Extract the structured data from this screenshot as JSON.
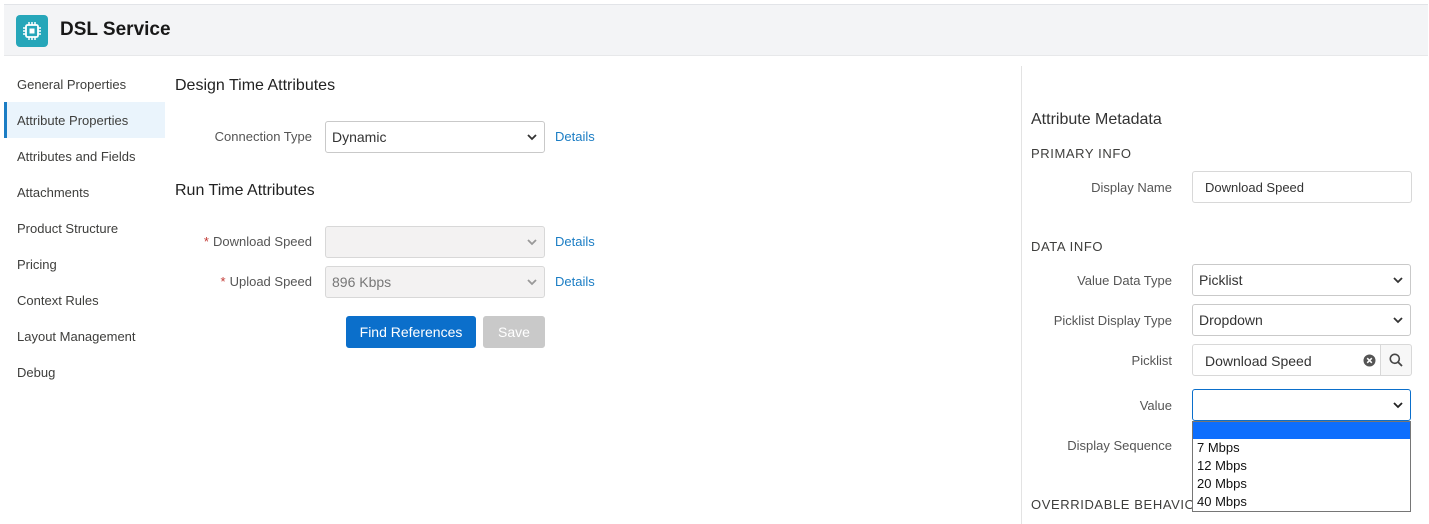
{
  "header": {
    "title": "DSL Service",
    "icon": "chip-icon",
    "accent": "#26a6b9"
  },
  "nav": {
    "items": [
      {
        "label": "General Properties"
      },
      {
        "label": "Attribute Properties",
        "active": true
      },
      {
        "label": "Attributes and Fields"
      },
      {
        "label": "Attachments"
      },
      {
        "label": "Product Structure"
      },
      {
        "label": "Pricing"
      },
      {
        "label": "Context Rules"
      },
      {
        "label": "Layout Management"
      },
      {
        "label": "Debug"
      }
    ]
  },
  "design_time": {
    "title": "Design Time Attributes",
    "connection_type": {
      "label": "Connection Type",
      "value": "Dynamic",
      "details": "Details"
    }
  },
  "run_time": {
    "title": "Run Time Attributes",
    "download_speed": {
      "required": "*",
      "label": "Download Speed",
      "value": "",
      "details": "Details"
    },
    "upload_speed": {
      "required": "*",
      "label": "Upload Speed",
      "value": "896 Kbps",
      "details": "Details"
    }
  },
  "buttons": {
    "find_references": "Find References",
    "save": "Save"
  },
  "metadata": {
    "title": "Attribute Metadata",
    "primary_info": {
      "title": "PRIMARY INFO",
      "display_name_label": "Display Name",
      "display_name_value": "Download Speed"
    },
    "data_info": {
      "title": "DATA INFO",
      "value_data_type_label": "Value Data Type",
      "value_data_type_value": "Picklist",
      "picklist_display_type_label": "Picklist Display Type",
      "picklist_display_type_value": "Dropdown",
      "picklist_label": "Picklist",
      "picklist_value": "Download Speed",
      "value_label": "Value",
      "value_value": "",
      "display_sequence_label": "Display Sequence"
    },
    "overridable_title": "OVERRIDABLE BEHAVIOR",
    "value_options": [
      "",
      "7 Mbps",
      "12 Mbps",
      "20 Mbps",
      "40 Mbps"
    ]
  }
}
